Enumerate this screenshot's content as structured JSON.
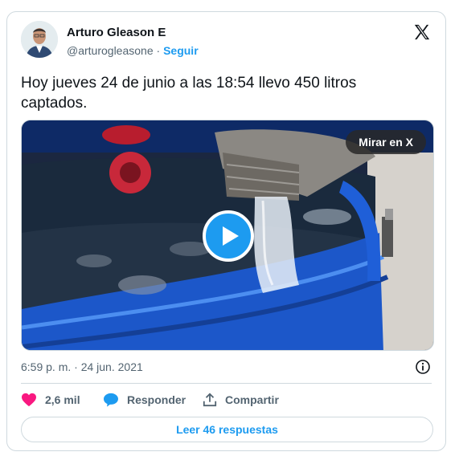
{
  "author": {
    "name": "Arturo Gleason E",
    "handle": "@arturogleasone",
    "separator": "·",
    "follow_label": "Seguir"
  },
  "tweet": {
    "text": "Hoy jueves 24 de junio a las 18:54 llevo 450 litros captados.",
    "timestamp": "6:59 p. m. · 24 jun. 2021"
  },
  "media": {
    "view_on_x_label": "Mirar en X"
  },
  "actions": {
    "likes": "2,6 mil",
    "reply_label": "Responder",
    "share_label": "Compartir"
  },
  "read_replies_label": "Leer 46 respuestas",
  "colors": {
    "accent": "#1d9bf0",
    "like": "#f91880",
    "text": "#0f1419",
    "muted": "#536471",
    "border": "#cfd9de"
  },
  "icons": [
    "x-logo-icon",
    "play-icon",
    "info-icon",
    "heart-icon",
    "reply-bubble-icon",
    "share-icon"
  ]
}
